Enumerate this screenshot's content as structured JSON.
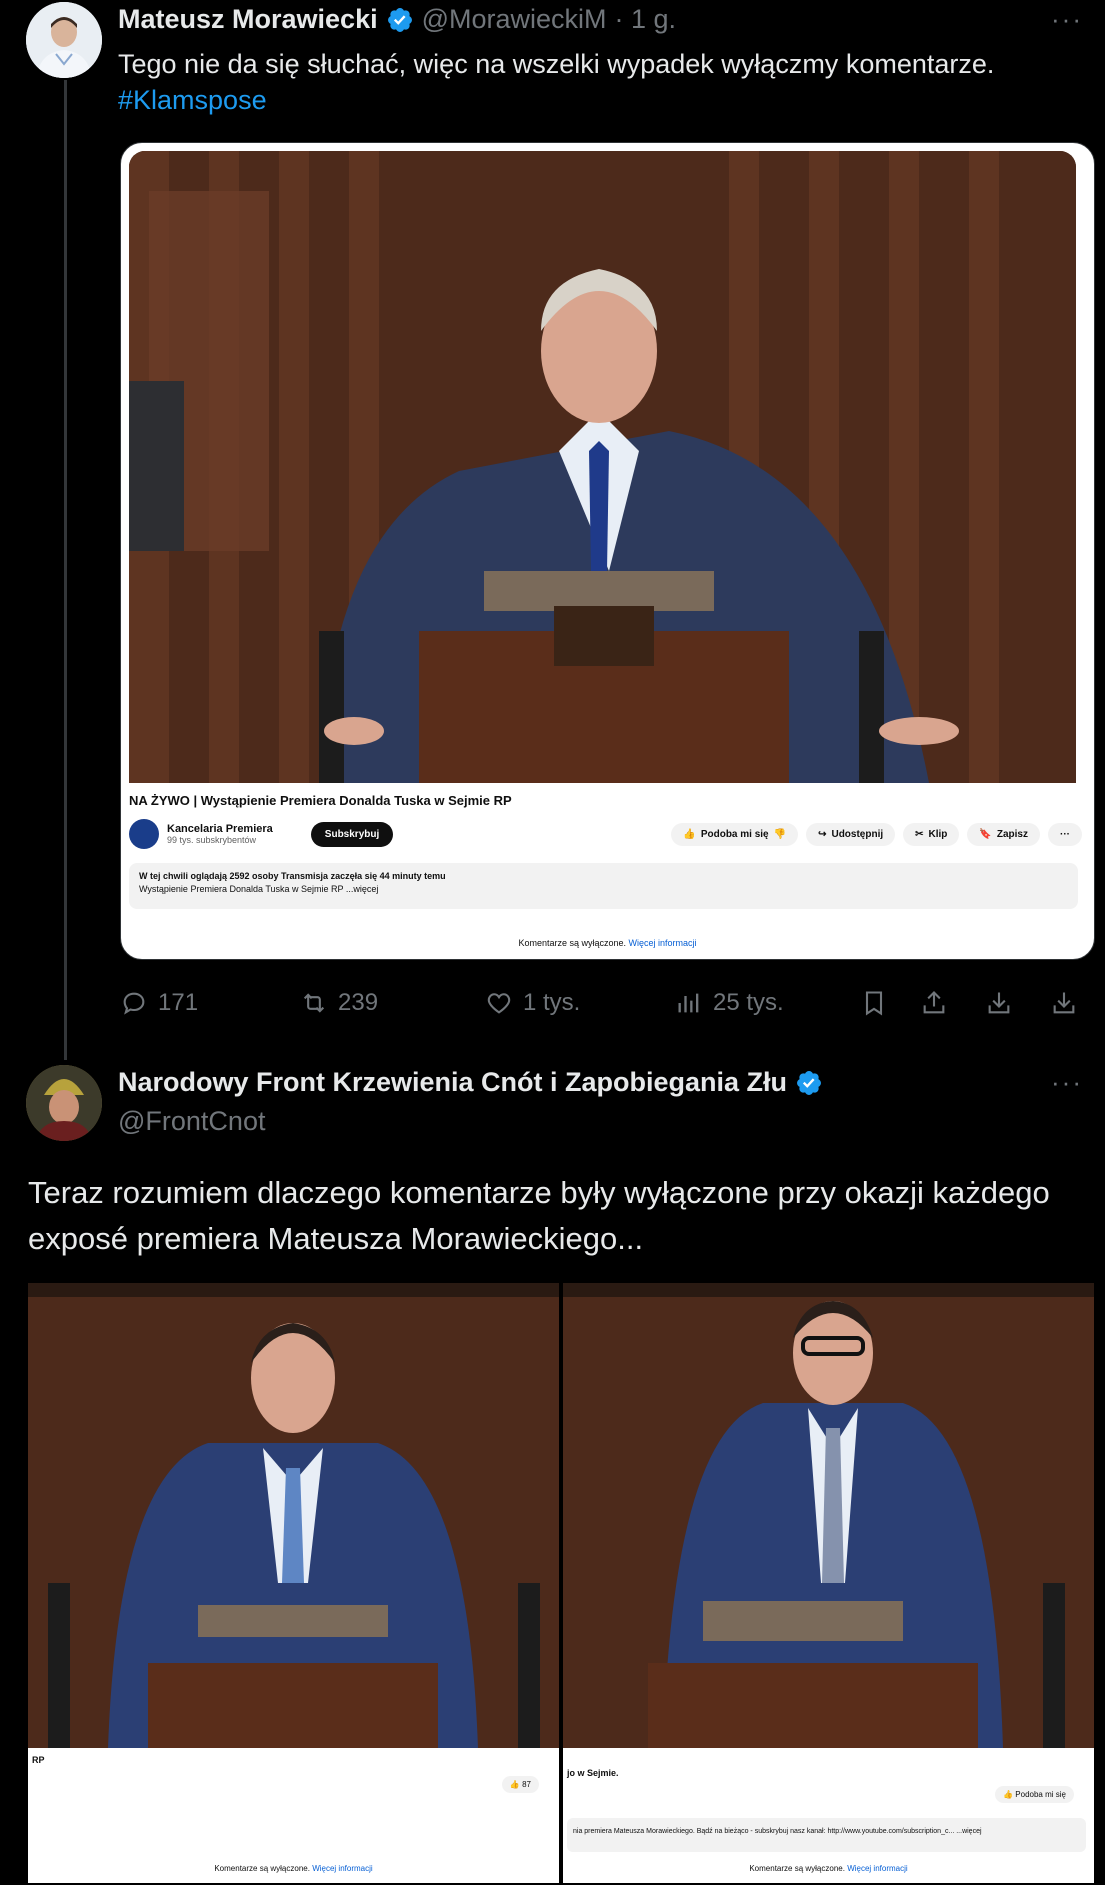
{
  "tweet1": {
    "author_name": "Mateusz Morawiecki",
    "handle": "@MorawieckiM",
    "time": "· 1 g.",
    "more": "···",
    "text": "Tego nie da się słuchać, więc na wszelki wypadek wyłączmy komentarze.",
    "hashtag": "#Klamspose",
    "embed": {
      "video_title": "NA ŻYWO | Wystąpienie Premiera Donalda Tuska w Sejmie RP",
      "channel_name": "Kancelaria Premiera",
      "channel_subs": "99 tys. subskrybentów",
      "subscribe_label": "Subskrybuj",
      "like_label": "Podoba mi się",
      "share_label": "Udostępnij",
      "clip_label": "Klip",
      "save_label": "Zapisz",
      "more_label": "···",
      "desc_line1": "W tej chwili oglądają 2592 osoby  Transmisja zaczęła się 44 minuty temu",
      "desc_line2": "Wystąpienie Premiera Donalda Tuska w Sejmie RP ...więcej",
      "comments_off": "Komentarze są wyłączone.",
      "more_info": "Więcej informacji"
    },
    "actions": {
      "replies": "171",
      "reposts": "239",
      "likes": "1 tys.",
      "views": "25 tys."
    }
  },
  "tweet2": {
    "author_name": "Narodowy Front Krzewienia Cnót i Zapobiegania Złu",
    "handle": "@FrontCnot",
    "more": "···",
    "text": "Teraz rozumiem dlaczego komentarze były wyłączone przy okazji każdego exposé premiera Mateusza Morawieckiego...",
    "left_image": {
      "caption": "RP",
      "like_count": "87",
      "comments_off": "Komentarze są wyłączone.",
      "more_info": "Więcej informacji"
    },
    "right_image": {
      "caption": "jo w Sejmie.",
      "like_label": "Podoba mi się",
      "desc": "nia premiera Mateusza Morawieckiego. Bądź na bieżąco - subskrybuj nasz kanał: http://www.youtube.com/subscription_c... ...więcej",
      "comments_off": "Komentarze są wyłączone.",
      "more_info": "Więcej informacji"
    }
  },
  "colors": {
    "background": "#000000",
    "text": "#e7e9ea",
    "muted": "#71767b",
    "link": "#1d9bf0",
    "verified": "#1d9bf0",
    "arrow": "#e3121b"
  }
}
